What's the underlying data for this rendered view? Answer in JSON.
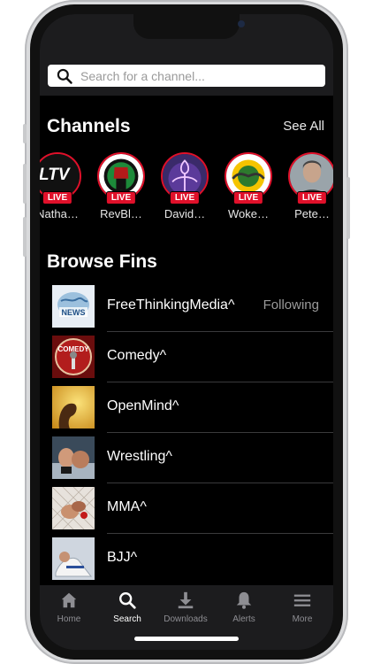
{
  "search": {
    "placeholder": "Search for a channel..."
  },
  "channels": {
    "title": "Channels",
    "see_all": "See All",
    "live_label": "LIVE",
    "items": [
      {
        "name": "Natha…",
        "avatar": "ltv-logo"
      },
      {
        "name": "RevBl…",
        "avatar": "fist-logo"
      },
      {
        "name": "David…",
        "avatar": "symbol-logo"
      },
      {
        "name": "Woke…",
        "avatar": "globe-logo"
      },
      {
        "name": "Pete…",
        "avatar": "man-photo"
      }
    ],
    "ltv_text": "LTV"
  },
  "browse": {
    "title": "Browse Fins",
    "items": [
      {
        "name": "FreeThinkingMedia^",
        "status": "Following",
        "thumb": "news-thumb",
        "thumb_text": "NEWS"
      },
      {
        "name": "Comedy^",
        "status": "",
        "thumb": "comedy-thumb",
        "thumb_text": "COMEDY"
      },
      {
        "name": "OpenMind^",
        "status": "",
        "thumb": "openmind-thumb"
      },
      {
        "name": "Wrestling^",
        "status": "",
        "thumb": "wrestling-thumb"
      },
      {
        "name": "MMA^",
        "status": "",
        "thumb": "mma-thumb"
      },
      {
        "name": "BJJ^",
        "status": "",
        "thumb": "bjj-thumb"
      }
    ]
  },
  "tabs": [
    {
      "label": "Home",
      "icon": "home-icon",
      "active": false
    },
    {
      "label": "Search",
      "icon": "search-icon",
      "active": true
    },
    {
      "label": "Downloads",
      "icon": "download-icon",
      "active": false
    },
    {
      "label": "Alerts",
      "icon": "bell-icon",
      "active": false
    },
    {
      "label": "More",
      "icon": "menu-icon",
      "active": false
    }
  ],
  "colors": {
    "live_red": "#e0102a",
    "background": "#000000",
    "bar_bg": "#1c1c1e",
    "muted_text": "#8e8e93"
  }
}
